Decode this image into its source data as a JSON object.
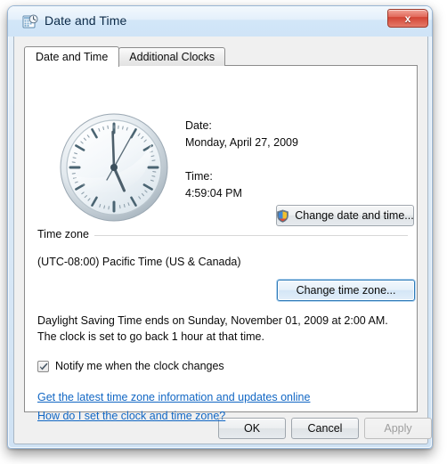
{
  "window": {
    "title": "Date and Time",
    "title_icon": "calendar-clock-icon",
    "close_label": "x"
  },
  "tabs": [
    {
      "label": "Date and Time",
      "active": true
    },
    {
      "label": "Additional Clocks",
      "active": false
    }
  ],
  "main": {
    "clock": {
      "icon": "analog-clock",
      "hour": 4,
      "minute": 59,
      "second": 4
    },
    "date_label": "Date:",
    "date_value": "Monday, April 27, 2009",
    "time_label": "Time:",
    "time_value": "4:59:04 PM",
    "change_datetime_button": {
      "label": "Change date and time...",
      "icon": "uac-shield-icon"
    },
    "timezone": {
      "group_label": "Time zone",
      "value": "(UTC-08:00) Pacific Time (US & Canada)",
      "change_button": "Change time zone..."
    },
    "dst_notice": "Daylight Saving Time ends on Sunday, November 01, 2009 at 2:00 AM. The clock is set to go back 1 hour at that time.",
    "notify_checkbox": {
      "label": "Notify me when the clock changes",
      "checked": true
    },
    "links": [
      "Get the latest time zone information and updates online",
      "How do I set the clock and time zone?"
    ]
  },
  "footer": {
    "ok": "OK",
    "cancel": "Cancel",
    "apply": "Apply"
  },
  "colors": {
    "link": "#1267c4",
    "titlebar_text": "#0c2a47",
    "close_button": "#d24434",
    "focus_border": "#2e7ab8"
  }
}
